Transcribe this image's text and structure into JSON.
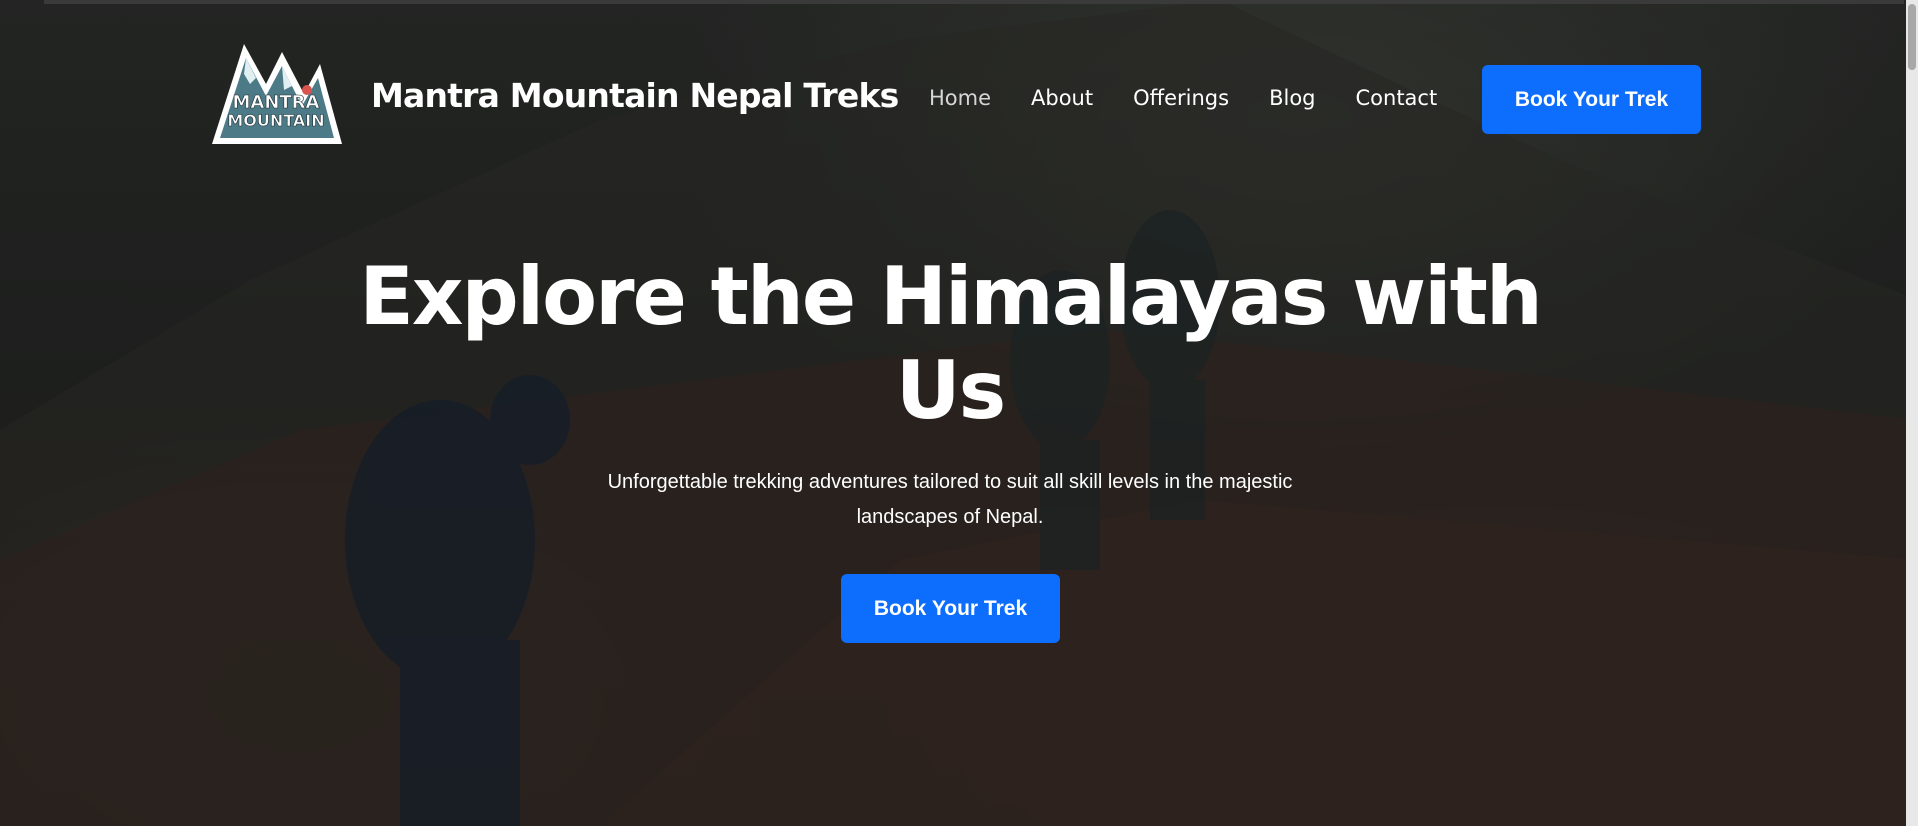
{
  "brand": {
    "logo_text_line1": "MANTRA",
    "logo_text_line2": "MOUNTAIN",
    "name": "Mantra Mountain Nepal Treks"
  },
  "nav": {
    "items": [
      {
        "label": "Home",
        "active": true
      },
      {
        "label": "About"
      },
      {
        "label": "Offerings"
      },
      {
        "label": "Blog"
      },
      {
        "label": "Contact"
      }
    ],
    "cta_label": "Book Your Trek"
  },
  "hero": {
    "title": "Explore the Himalayas with Us",
    "subtitle": "Unforgettable trekking adventures tailored to suit all skill levels in the majestic landscapes of Nepal.",
    "cta_label": "Book Your Trek"
  },
  "colors": {
    "accent": "#0d6efd",
    "text": "#ffffff"
  }
}
